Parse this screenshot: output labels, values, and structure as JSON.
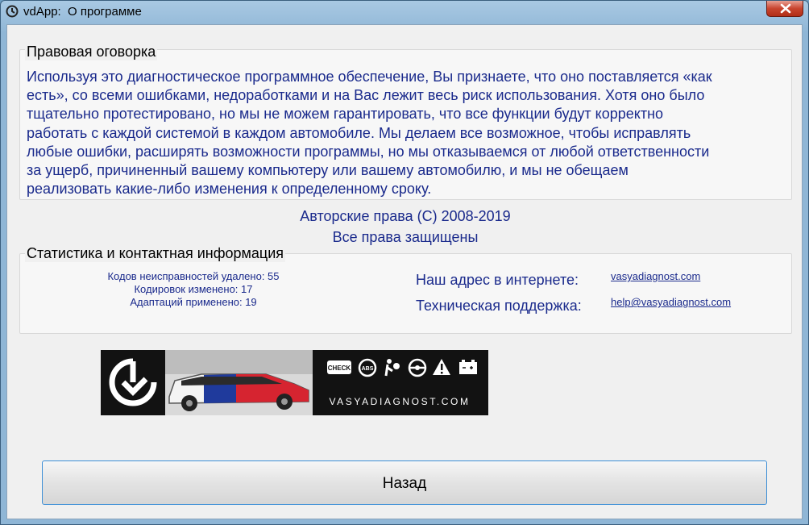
{
  "window": {
    "title": "vdApp:  О программе"
  },
  "disclaimer": {
    "legend": "Правовая оговорка",
    "lines": [
      "Используя это диагностическое программное обеспечение, Вы признаете, что оно поставляется «как",
      "есть», со всеми ошибками, недоработками и на Вас лежит весь риск использования. Хотя оно было",
      "тщательно протестировано, но мы не можем гарантировать, что все функции будут корректно",
      "работать с каждой системой в каждом автомобиле. Мы делаем все возможное, чтобы исправлять",
      "любые ошибки, расширять возможности программы, но мы отказываемся от любой ответственности",
      "за ущерб, причиненный  вашему компьютеру или вашему автомобилю, и мы не обещаем",
      "реализовать какие-либо изменения к определенному сроку."
    ]
  },
  "copyright": {
    "line1": "Авторские права (C) 2008-2019",
    "line2": "Все права защищены"
  },
  "stats": {
    "legend": "Статистика и контактная информация",
    "dtc_cleared": "Кодов неисправностей удалено: 55",
    "codings_changed": "Кодировок изменено: 17",
    "adaptations_applied": "Адаптаций применено: 19",
    "web_label": "Наш адрес в интернете:",
    "web_link": "vasyadiagnost.com",
    "support_label": "Техническая поддержка:",
    "support_link": "help@vasyadiagnost.com"
  },
  "banner": {
    "brand_text": "VASYADIAGNOST.COM",
    "check_badge": "CHECK",
    "abs_badge": "ABS",
    "colors": {
      "background": "#121212",
      "blue": "#1f3a9c",
      "red": "#d62430"
    }
  },
  "footer": {
    "back_label": "Назад"
  }
}
